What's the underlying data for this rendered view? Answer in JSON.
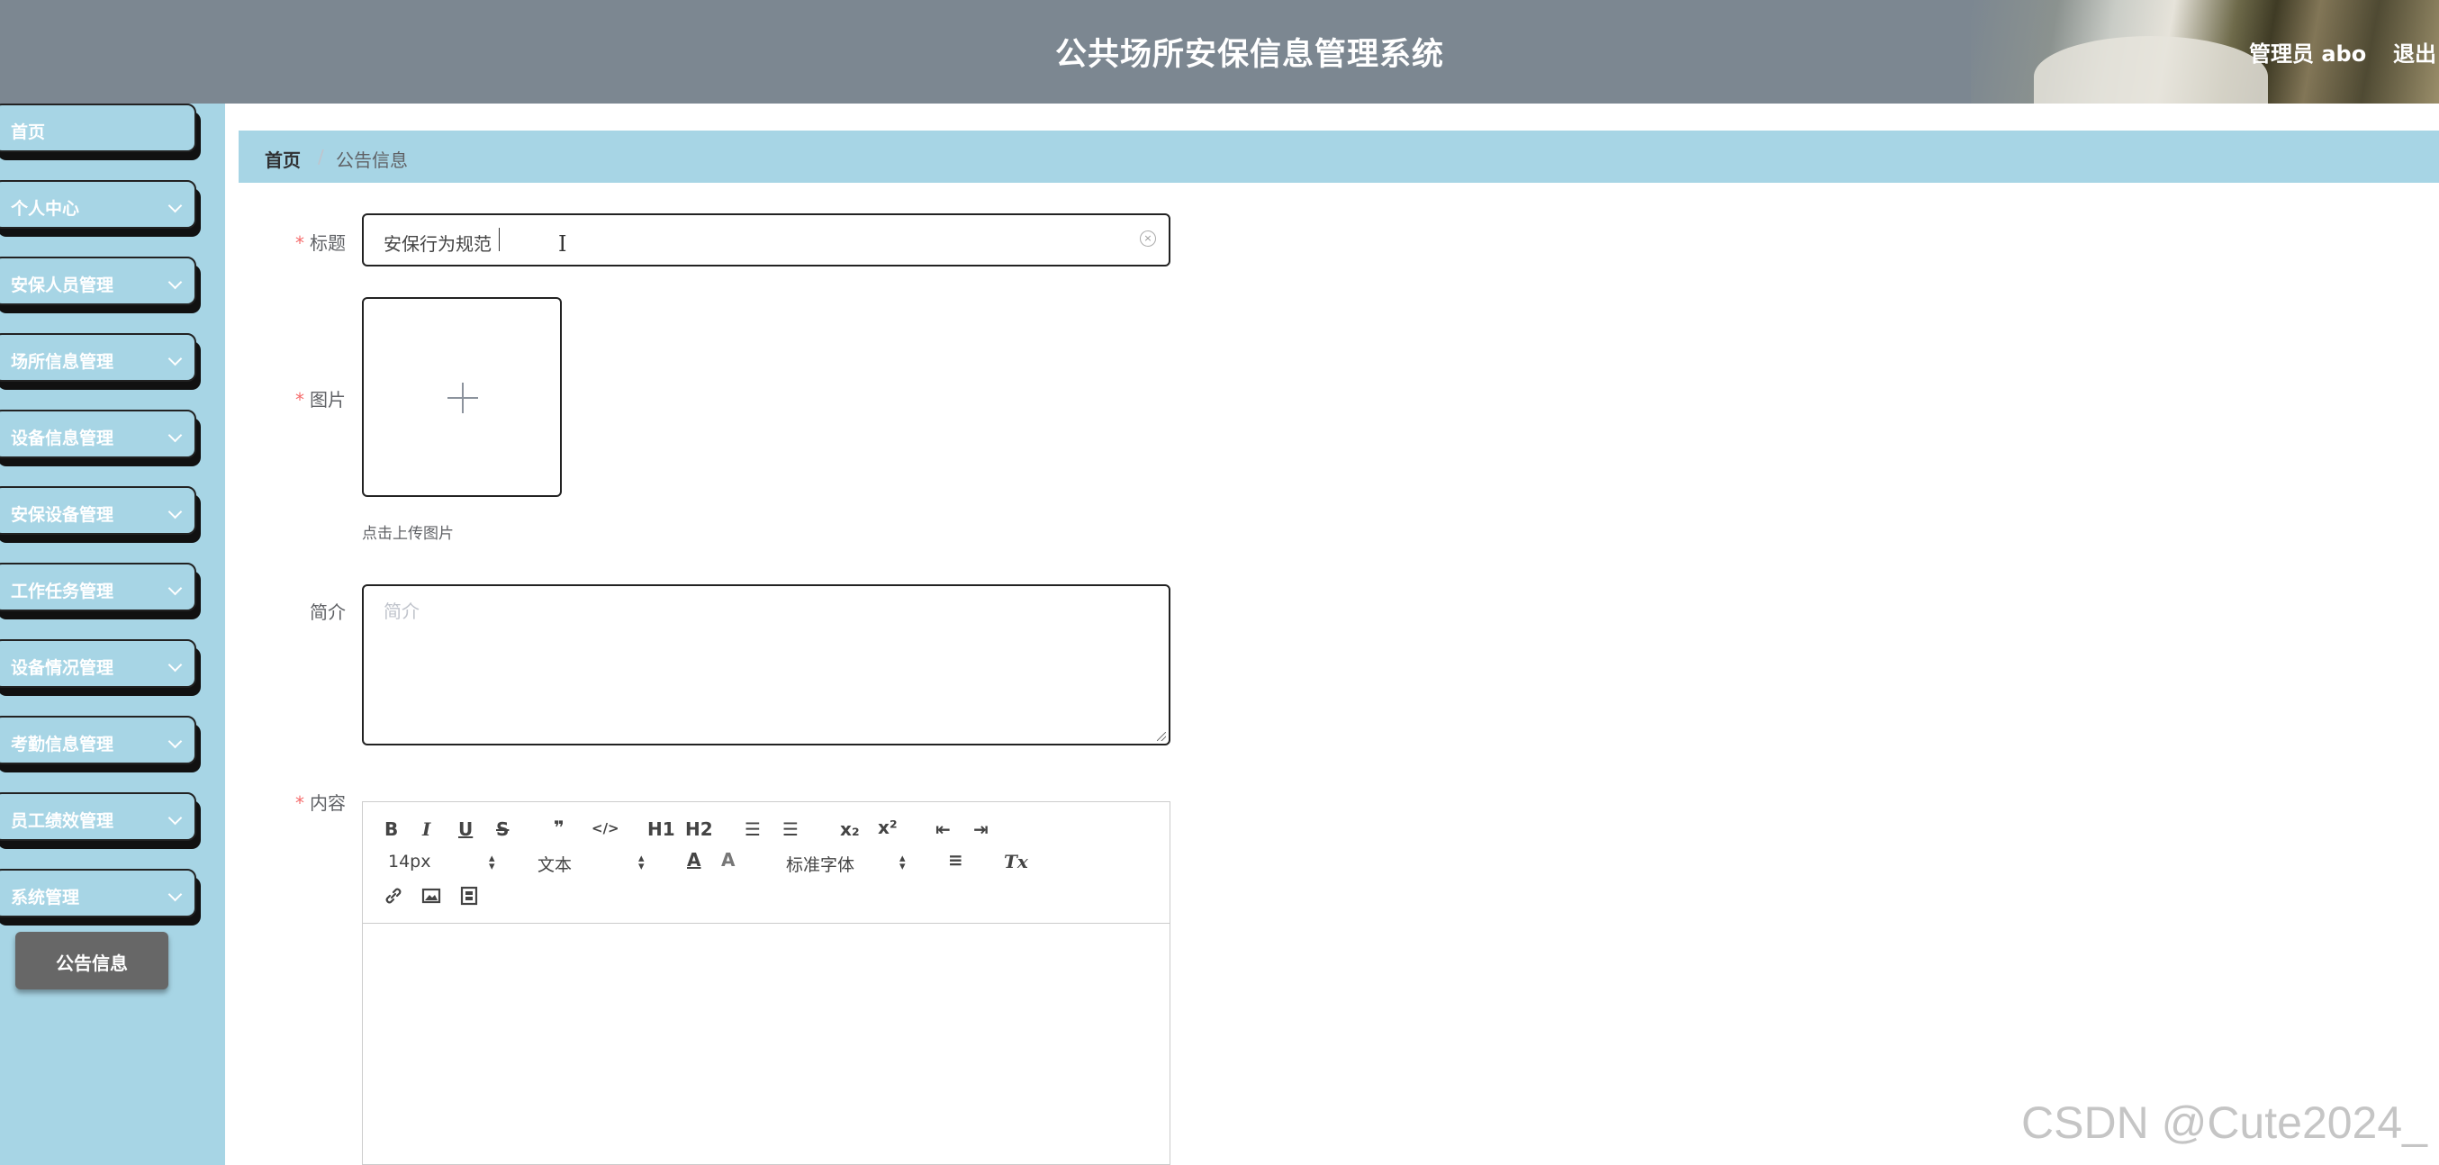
{
  "header": {
    "app_title": "公共场所安保信息管理系统",
    "user_label": "管理员 abo",
    "logout_label": "退出"
  },
  "sidebar": {
    "items": [
      {
        "label": "首页",
        "has_children": false
      },
      {
        "label": "个人中心",
        "has_children": true
      },
      {
        "label": "安保人员管理",
        "has_children": true
      },
      {
        "label": "场所信息管理",
        "has_children": true
      },
      {
        "label": "设备信息管理",
        "has_children": true
      },
      {
        "label": "安保设备管理",
        "has_children": true
      },
      {
        "label": "工作任务管理",
        "has_children": true
      },
      {
        "label": "设备情况管理",
        "has_children": true
      },
      {
        "label": "考勤信息管理",
        "has_children": true
      },
      {
        "label": "员工绩效管理",
        "has_children": true
      },
      {
        "label": "系统管理",
        "has_children": true
      }
    ],
    "active_subitem": "公告信息"
  },
  "breadcrumb": {
    "home": "首页",
    "separator": "/",
    "current": "公告信息"
  },
  "form": {
    "title": {
      "label": "标题",
      "required": true,
      "value": "安保行为规范"
    },
    "image": {
      "label": "图片",
      "required": true,
      "tip": "点击上传图片"
    },
    "summary": {
      "label": "简介",
      "required": false,
      "placeholder": "简介",
      "value": ""
    },
    "content": {
      "label": "内容",
      "required": true
    }
  },
  "editor_toolbar": {
    "bold": "B",
    "italic": "I",
    "underline": "U",
    "strike": "S",
    "quote": "❞",
    "code": "</>",
    "h1": "H1",
    "h2": "H2",
    "ordered_list": "☰",
    "bullet_list": "☰",
    "subscript": "x₂",
    "superscript": "x²",
    "outdent": "⇤",
    "indent": "⇥",
    "size_value": "14px",
    "header_value": "文本",
    "font_value": "标准字体",
    "color": "A",
    "background": "A",
    "align": "≡",
    "clean": "Tx",
    "link_icon": "link-icon",
    "image_icon": "image-icon",
    "video_icon": "video-icon"
  },
  "watermark": "CSDN @Cute2024_",
  "colors": {
    "header_bg": "#7c8791",
    "sidebar_bg": "#a7d5e5",
    "active_subitem_bg": "#676767",
    "required_star": "#f56c6c"
  }
}
